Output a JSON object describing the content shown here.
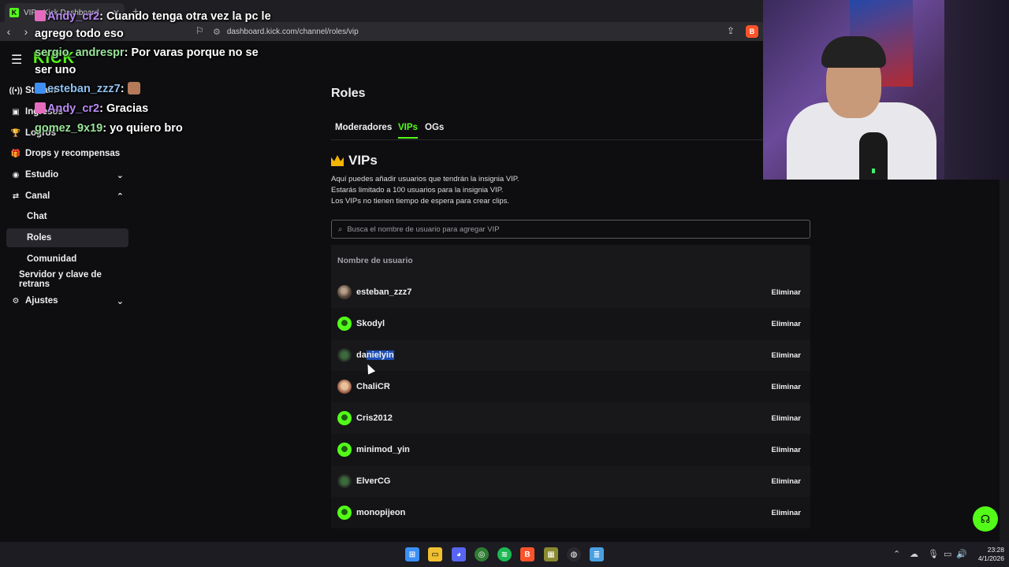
{
  "browser": {
    "tab_title": "VIP - Kick Dashboard",
    "url": "dashboard.kick.com/channel/roles/vip"
  },
  "header": {
    "logo": "KICK"
  },
  "sidebar": {
    "items": [
      {
        "label": "Stream",
        "icon": "broadcast-icon"
      },
      {
        "label": "Ingresos",
        "icon": "wallet-icon"
      },
      {
        "label": "Logros",
        "icon": "trophy-icon"
      },
      {
        "label": "Drops y recompensas",
        "icon": "gift-icon"
      },
      {
        "label": "Estudio",
        "icon": "studio-icon"
      },
      {
        "label": "Canal",
        "icon": "channel-icon"
      },
      {
        "label": "Chat"
      },
      {
        "label": "Roles"
      },
      {
        "label": "Comunidad"
      },
      {
        "label": "Servidor y clave de retrans"
      },
      {
        "label": "Ajustes",
        "icon": "gear-icon"
      }
    ]
  },
  "chat_overlay": [
    {
      "user": "Andy_cr2",
      "text": "Cuando tenga otra vez la pc le agrego todo eso"
    },
    {
      "user": "sergio_andrespr",
      "text": "Por varas porque no se ser uno"
    },
    {
      "user": "esteban_zzz7",
      "text": ""
    },
    {
      "user": "Andy_cr2",
      "text": "Gracias"
    },
    {
      "user": "gomez_9x19",
      "text": "yo quiero bro"
    }
  ],
  "main": {
    "title": "Roles",
    "tabs": [
      "Moderadores",
      "VIPs",
      "OGs"
    ],
    "active_tab": "VIPs",
    "vip_heading": "VIPs",
    "description": [
      "Aquí puedes añadir usuarios que tendrán la insignia VIP.",
      "Estarás limitado a 100 usuarios para la insignia VIP.",
      "Los VIPs no tienen tiempo de espera para crear clips."
    ],
    "search_placeholder": "Busca el nombre de usuario para agregar VIP",
    "column_header": "Nombre de usuario",
    "delete_label": "Eliminar",
    "users": [
      {
        "name": "esteban_zzz7",
        "avatar": "d"
      },
      {
        "name": "Skodyl",
        "avatar": "g"
      },
      {
        "name": "danielyin",
        "avatar": "e"
      },
      {
        "name": "ChaliCR",
        "avatar": "c"
      },
      {
        "name": "Cris2012",
        "avatar": "g"
      },
      {
        "name": "minimod_yin",
        "avatar": "g"
      },
      {
        "name": "ElverCG",
        "avatar": "e"
      },
      {
        "name": "monopijeon",
        "avatar": "g"
      }
    ]
  },
  "taskbar": {
    "time": "23:28",
    "date": "4/1/2026"
  },
  "colors": {
    "accent": "#53fc18",
    "bg": "#0e0e10",
    "row": "#18181b"
  }
}
